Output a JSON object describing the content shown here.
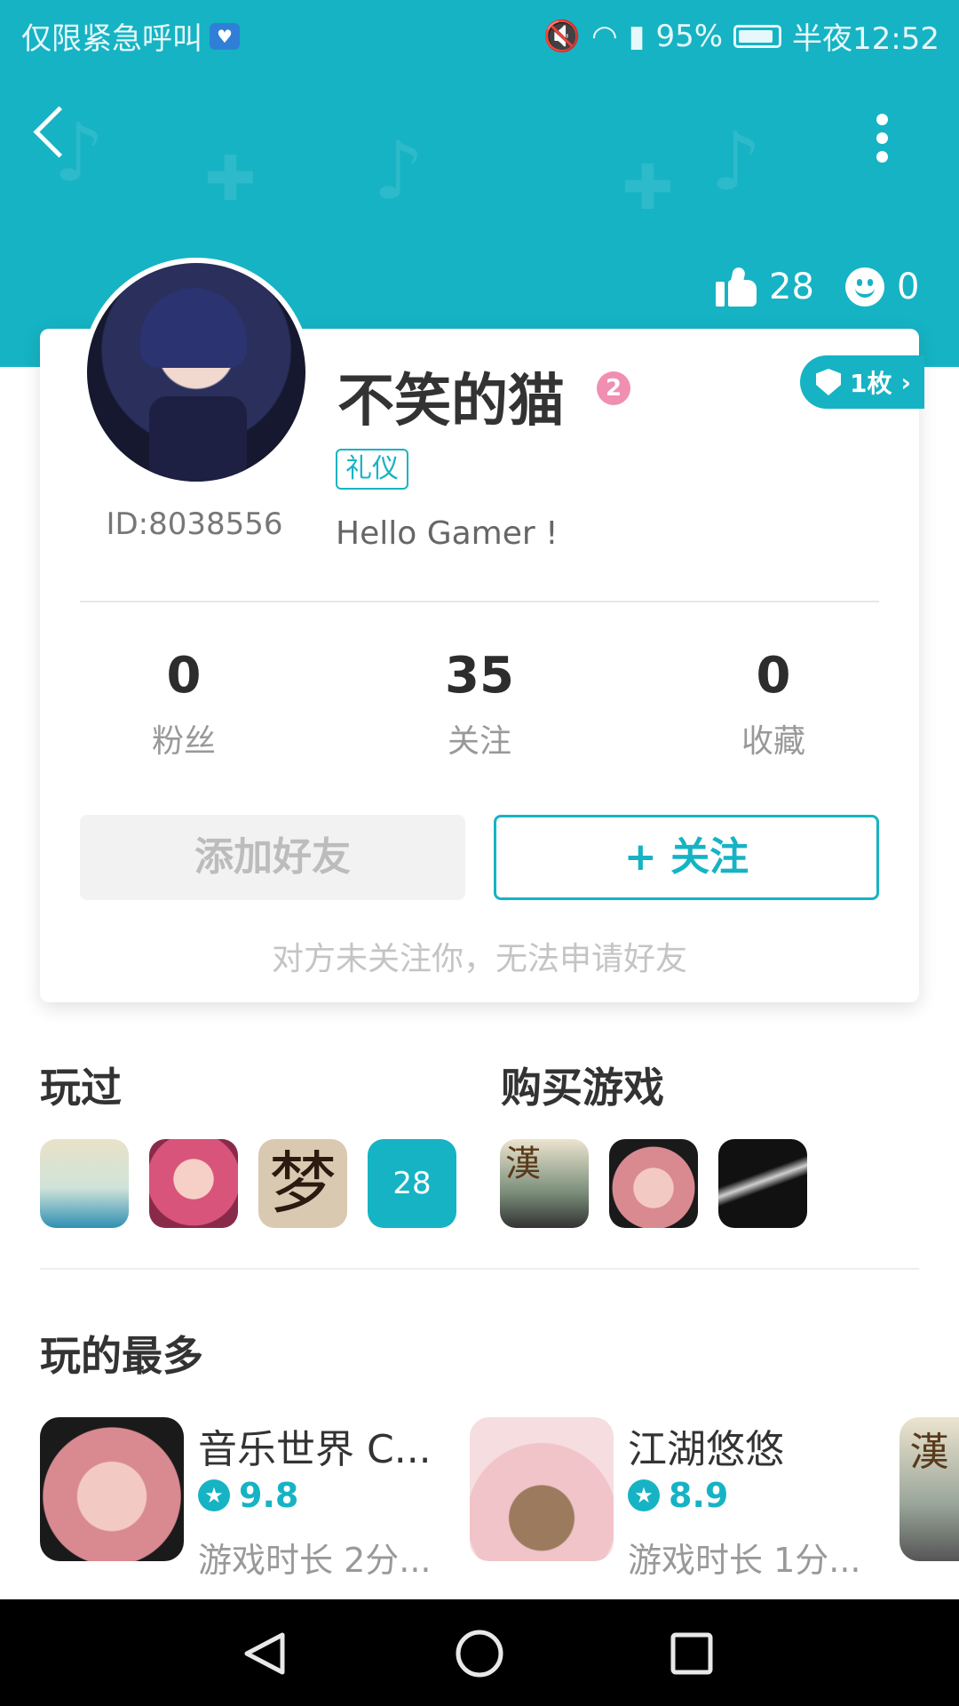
{
  "status_bar": {
    "left_text": "仅限紧急呼叫",
    "battery": "95%",
    "time": "半夜12:52"
  },
  "header": {
    "likes": "28",
    "smiles": "0"
  },
  "profile": {
    "name": "不笑的猫",
    "level": "2",
    "badge_count": "1枚",
    "tag": "礼仪",
    "id": "ID:8038556",
    "bio": "Hello Gamer !"
  },
  "stats": [
    {
      "value": "0",
      "label": "粉丝"
    },
    {
      "value": "35",
      "label": "关注"
    },
    {
      "value": "0",
      "label": "收藏"
    }
  ],
  "actions": {
    "add_friend": "添加好友",
    "follow": "+ 关注",
    "hint": "对方未关注你，无法申请好友"
  },
  "played": {
    "title": "玩过",
    "more_count": "28"
  },
  "bought": {
    "title": "购买游戏"
  },
  "most_played": {
    "title": "玩的最多",
    "items": [
      {
        "name": "音乐世界 C...",
        "rating": "9.8",
        "time": "游戏时长 2分..."
      },
      {
        "name": "江湖悠悠",
        "rating": "8.9",
        "time": "游戏时长 1分..."
      }
    ]
  },
  "colors": {
    "accent": "#16b3c4",
    "level_pink": "#f08fb2"
  }
}
